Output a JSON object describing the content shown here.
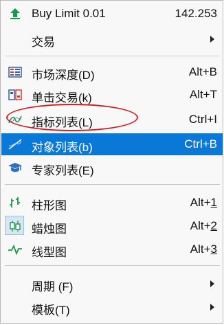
{
  "menu": {
    "buy_limit": {
      "label": "Buy Limit 0.01",
      "shortcut": "142.253",
      "icon": "buy-limit-arrow-icon"
    },
    "trade": {
      "label": "交易",
      "icon": "",
      "submenu": true
    },
    "market_depth": {
      "label": "市场深度(D)",
      "shortcut": "Alt+B",
      "icon": "market-depth-icon"
    },
    "one_click": {
      "label": "单击交易(k)",
      "shortcut": "Alt+T",
      "icon": "one-click-trading-icon"
    },
    "indicators": {
      "label": "指标列表(L)",
      "shortcut": "Ctrl+I",
      "icon": "indicators-icon"
    },
    "objects": {
      "label": "对象列表(b)",
      "shortcut": "Ctrl+B",
      "icon": "objects-icon"
    },
    "experts": {
      "label": "专家列表(E)",
      "shortcut": "",
      "icon": "experts-cap-icon"
    },
    "bar_chart": {
      "label": "柱形图",
      "shortcut_prefix": "Alt+",
      "shortcut_key": "1",
      "icon": "bar-chart-icon"
    },
    "candlestick": {
      "label": "蜡烛图",
      "shortcut_prefix": "Alt+",
      "shortcut_key": "2",
      "icon": "candlestick-icon"
    },
    "line_chart": {
      "label": "线型图",
      "shortcut_prefix": "Alt+",
      "shortcut_key": "3",
      "icon": "line-chart-icon"
    },
    "period": {
      "label": "周期 (F)",
      "submenu": true
    },
    "template": {
      "label": "模板(T)",
      "submenu": true
    }
  },
  "colors": {
    "selected_bg": "#0a78d7",
    "annotation_circle": "#d71d1d",
    "menu_bg": "#f8f8f8"
  }
}
